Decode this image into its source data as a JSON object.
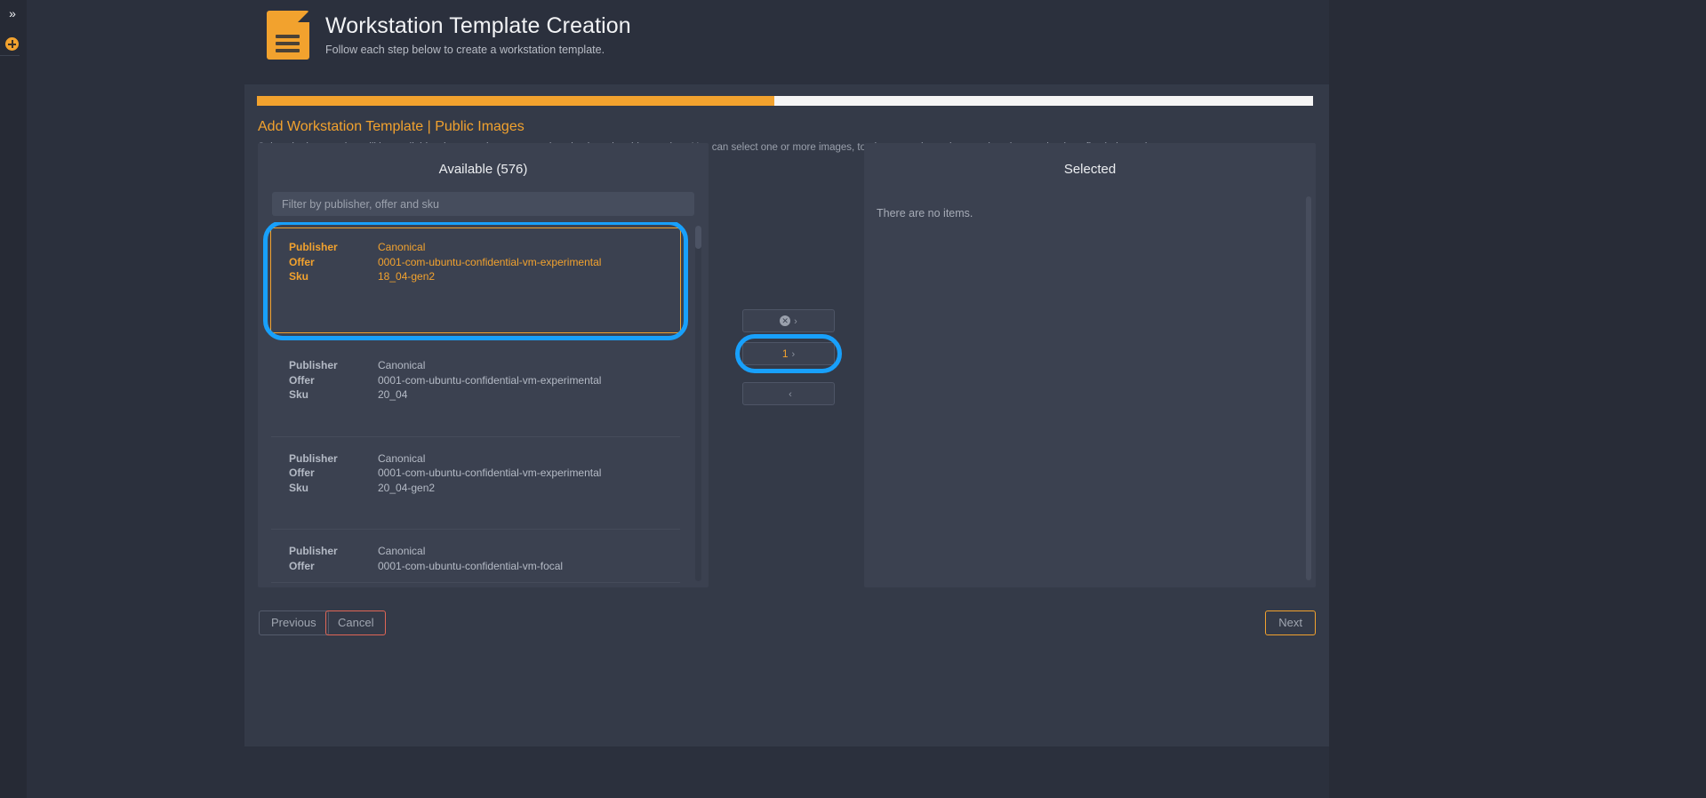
{
  "rail": {
    "expand_icon": "double-chevron-right-icon",
    "expand_glyph": "»",
    "add_icon": "plus-circle-icon"
  },
  "header": {
    "icon": "document-icon",
    "title": "Workstation Template Creation",
    "subtitle": "Follow each step below to create a workstation template."
  },
  "wizard": {
    "progress_percent": 49,
    "step_title": "Add Workstation Template | Public Images",
    "step_description": "Select the images that will be available when creating a new workstation by using this template. You can select one or more images, to give users the option to select the one that best fits their needs."
  },
  "available": {
    "title": "Available (576)",
    "count": 576,
    "filter_placeholder": "Filter by publisher, offer and sku",
    "filter_value": "",
    "labels": {
      "publisher": "Publisher",
      "offer": "Offer",
      "sku": "Sku"
    },
    "items": [
      {
        "publisher": "Canonical",
        "offer": "0001-com-ubuntu-confidential-vm-experimental",
        "sku": "18_04-gen2",
        "selected": true
      },
      {
        "publisher": "Canonical",
        "offer": "0001-com-ubuntu-confidential-vm-experimental",
        "sku": "20_04",
        "selected": false
      },
      {
        "publisher": "Canonical",
        "offer": "0001-com-ubuntu-confidential-vm-experimental",
        "sku": "20_04-gen2",
        "selected": false
      },
      {
        "publisher": "Canonical",
        "offer": "0001-com-ubuntu-confidential-vm-focal",
        "sku": "",
        "selected": false
      }
    ]
  },
  "transfer": {
    "move_all_label": "",
    "move_all_icon": "circle-x-icon",
    "move_all_glyph": "✕",
    "move_selected_count": "1",
    "chevron_right": "›",
    "chevron_left": "‹"
  },
  "selected": {
    "title": "Selected",
    "empty_message": "There are no items."
  },
  "footer": {
    "previous_label": "Previous",
    "cancel_label": "Cancel",
    "next_label": "Next"
  },
  "colors": {
    "accent": "#f2a22e",
    "focus_ring": "#18a0fb",
    "danger": "#e06656",
    "panel_bg": "#3b4150",
    "card_bg": "#343a48",
    "page_bg": "#2b303d"
  }
}
